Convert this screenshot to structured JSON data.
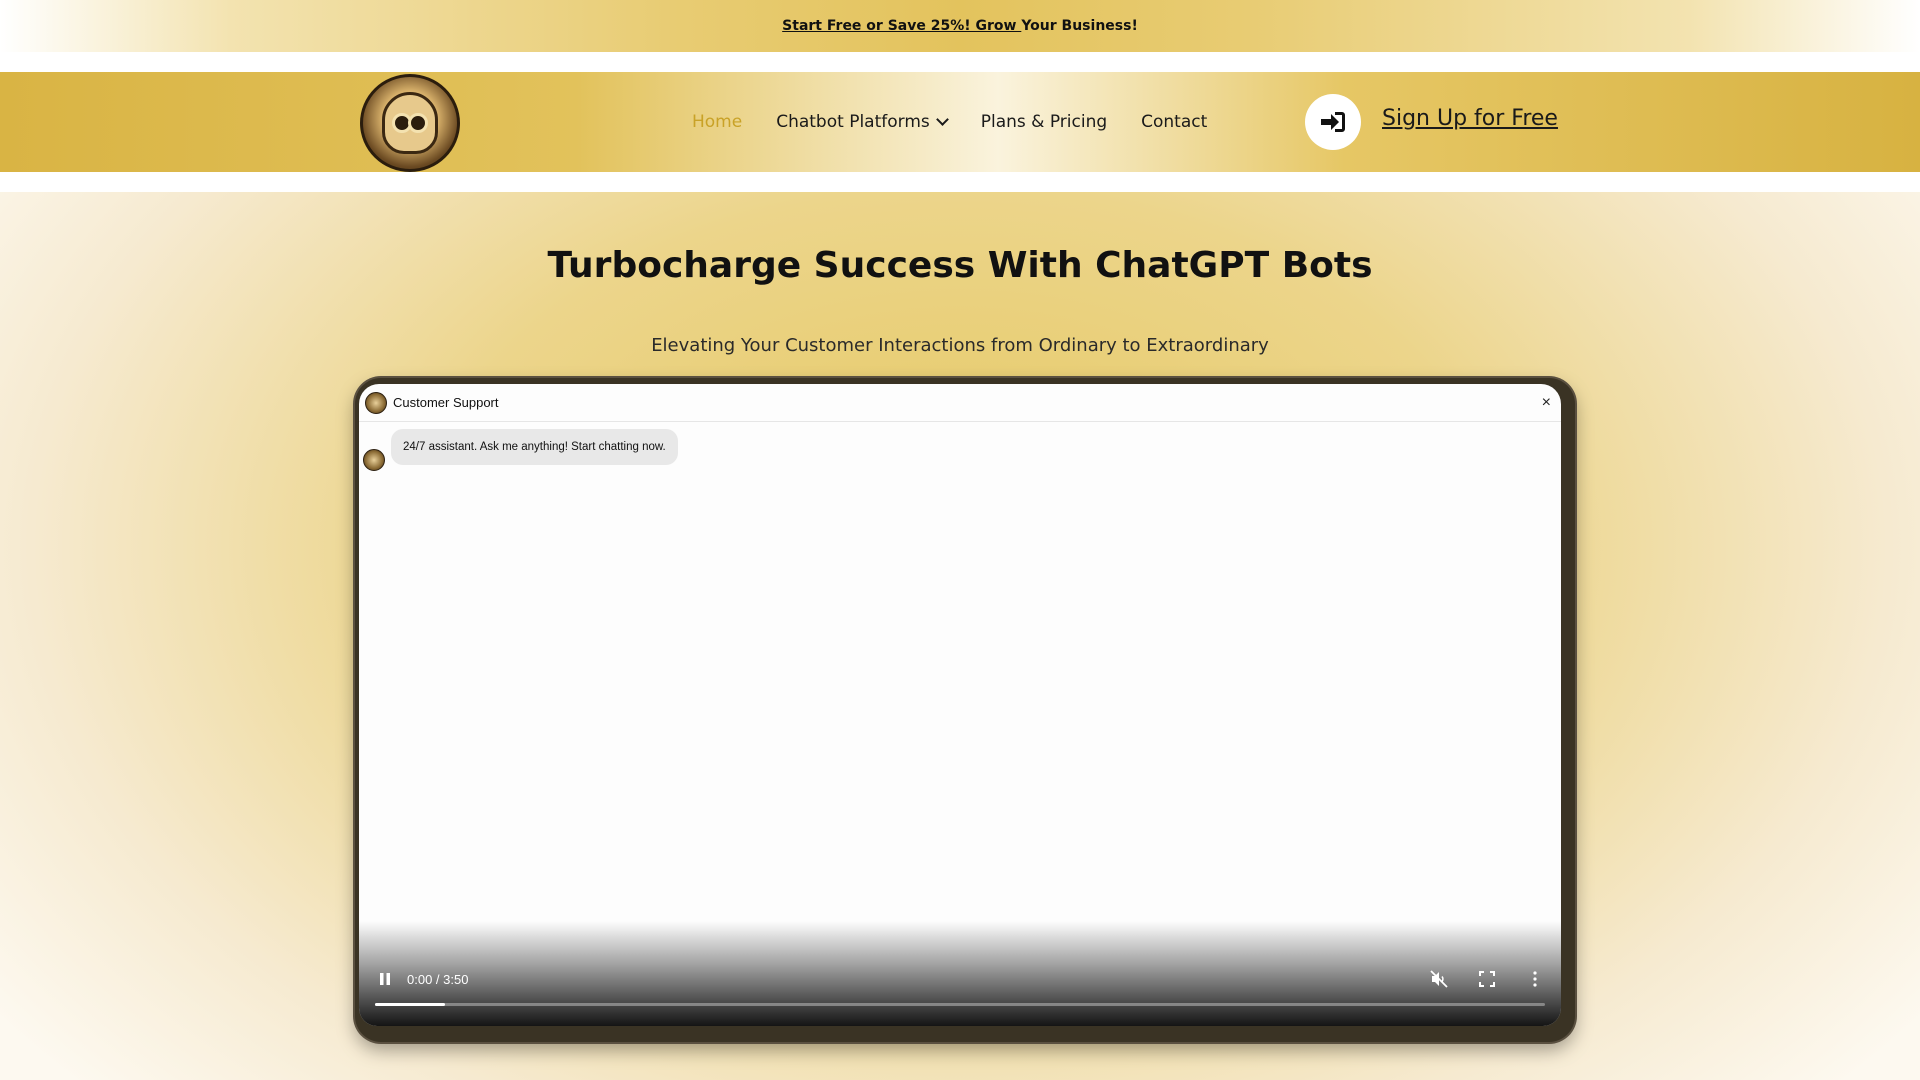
{
  "promo": {
    "link_text": "Start Free or Save 25%! Grow ",
    "tail_text": "Your Business!"
  },
  "header": {
    "nav": [
      {
        "label": "Home",
        "active": true
      },
      {
        "label": "Chatbot Platforms",
        "has_dropdown": true
      },
      {
        "label": "Plans & Pricing"
      },
      {
        "label": "Contact"
      }
    ],
    "signup_label": "Sign Up for Free",
    "signin_icon": "sign-in-icon",
    "active_color": "#c9a227"
  },
  "hero": {
    "title": "Turbocharge Success With ChatGPT Bots",
    "subtitle": "Elevating Your Customer Interactions from Ordinary to Extraordinary"
  },
  "chat": {
    "title": "Customer Support",
    "close_glyph": "×",
    "message": "24/7 assistant. Ask me anything! Start chatting now."
  },
  "video": {
    "time": "0:00 / 3:50",
    "progress_fraction": 0.06,
    "state": "playing",
    "muted": true
  }
}
